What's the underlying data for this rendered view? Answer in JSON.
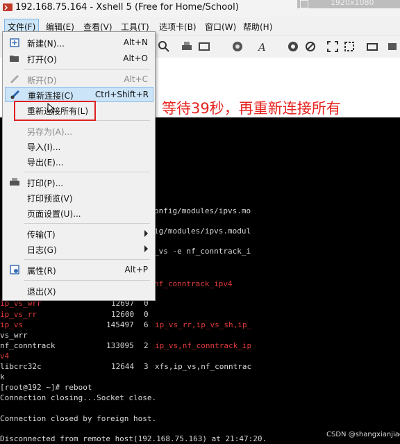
{
  "window": {
    "title": "192.168.75.164 - Xshell 5 (Free for Home/School)",
    "badge": "1920x1080"
  },
  "menubar": [
    {
      "label": "文件(F)"
    },
    {
      "label": "编辑(E)"
    },
    {
      "label": "查看(V)"
    },
    {
      "label": "工具(T)"
    },
    {
      "label": "选项卡(B)"
    },
    {
      "label": "窗口(W)"
    },
    {
      "label": "帮助(H)"
    }
  ],
  "file_menu": {
    "new": {
      "label": "新建(N)...",
      "shortcut": "Alt+N"
    },
    "open": {
      "label": "打开(O)",
      "shortcut": "Alt+O"
    },
    "disconnect": {
      "label": "断开(D)",
      "shortcut": "Alt+C"
    },
    "reconnect": {
      "label": "重新连接(C)",
      "shortcut": "Ctrl+Shift+R"
    },
    "reconnect_all": {
      "label": "重新连接所有(L)"
    },
    "save_as": {
      "label": "另存为(A)..."
    },
    "import": {
      "label": "导入(I)..."
    },
    "export": {
      "label": "导出(E)..."
    },
    "print": {
      "label": "打印(P)..."
    },
    "print_preview": {
      "label": "打印预览(V)"
    },
    "page_setup": {
      "label": "页面设置(U)..."
    },
    "transfer": {
      "label": "传输(T)"
    },
    "log": {
      "label": "日志(G)"
    },
    "properties": {
      "label": "属性(R)",
      "shortcut": "Alt+P"
    },
    "exit": {
      "label": "退出(X)"
    }
  },
  "annotation": "等待39秒，再重新连接所有",
  "terminal": {
    "lines": [
      {
        "prefix": "",
        "text": "onfig/modules/ipvs.mo"
      },
      {
        "prefix": "",
        "text": "ig/modules/ipvs.modul"
      },
      {
        "prefix": "",
        "text": "_vs -e nf_conntrack_i"
      },
      {
        "prefix": "",
        "text": "nf_conntrack_ipv4"
      }
    ],
    "rows": [
      {
        "c1": "ip_vs_wrr",
        "c2": "12697",
        "c3": "0",
        "c4": ""
      },
      {
        "c1": "ip_vs_rr",
        "c2": "12600",
        "c3": "0",
        "c4": ""
      },
      {
        "c1": "ip_vs",
        "c2": "145497",
        "c3": "6",
        "c4": "ip_vs_rr,ip_vs_sh,ip_"
      },
      {
        "c1": "vs_wrr",
        "c2": "",
        "c3": "",
        "c4": ""
      },
      {
        "c1": "nf_conntrack",
        "c2": "133095",
        "c3": "2",
        "c4": "ip_vs,nf_conntrack_ip"
      },
      {
        "c1": "v4",
        "c2": "",
        "c3": "",
        "c4": ""
      },
      {
        "c1": "libcrc32c",
        "c2": "12644",
        "c3": "3",
        "c4": "xfs,ip_vs,nf_conntrac"
      },
      {
        "c1": "k",
        "c2": "",
        "c3": "",
        "c4": ""
      }
    ],
    "prompt": "[root@192 ~]# reboot",
    "closing": "Connection closing...Socket close.",
    "closed": "Connection closed by foreign host.",
    "disconnected": "Disconnected from remote host(192.168.75.163) at 21:47:20."
  },
  "watermark": "CSDN @shangxianjiao"
}
